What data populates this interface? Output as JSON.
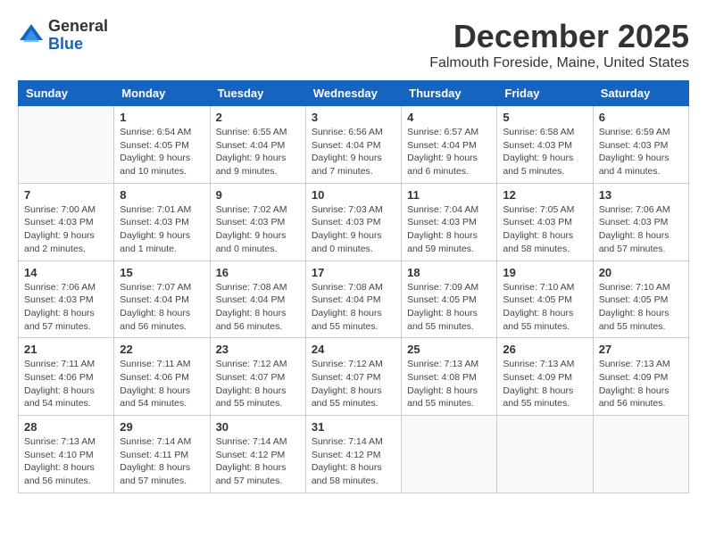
{
  "header": {
    "logo_general": "General",
    "logo_blue": "Blue",
    "month_title": "December 2025",
    "location": "Falmouth Foreside, Maine, United States"
  },
  "days_of_week": [
    "Sunday",
    "Monday",
    "Tuesday",
    "Wednesday",
    "Thursday",
    "Friday",
    "Saturday"
  ],
  "weeks": [
    [
      {
        "day": "",
        "info": ""
      },
      {
        "day": "1",
        "info": "Sunrise: 6:54 AM\nSunset: 4:05 PM\nDaylight: 9 hours\nand 10 minutes."
      },
      {
        "day": "2",
        "info": "Sunrise: 6:55 AM\nSunset: 4:04 PM\nDaylight: 9 hours\nand 9 minutes."
      },
      {
        "day": "3",
        "info": "Sunrise: 6:56 AM\nSunset: 4:04 PM\nDaylight: 9 hours\nand 7 minutes."
      },
      {
        "day": "4",
        "info": "Sunrise: 6:57 AM\nSunset: 4:04 PM\nDaylight: 9 hours\nand 6 minutes."
      },
      {
        "day": "5",
        "info": "Sunrise: 6:58 AM\nSunset: 4:03 PM\nDaylight: 9 hours\nand 5 minutes."
      },
      {
        "day": "6",
        "info": "Sunrise: 6:59 AM\nSunset: 4:03 PM\nDaylight: 9 hours\nand 4 minutes."
      }
    ],
    [
      {
        "day": "7",
        "info": "Sunrise: 7:00 AM\nSunset: 4:03 PM\nDaylight: 9 hours\nand 2 minutes."
      },
      {
        "day": "8",
        "info": "Sunrise: 7:01 AM\nSunset: 4:03 PM\nDaylight: 9 hours\nand 1 minute."
      },
      {
        "day": "9",
        "info": "Sunrise: 7:02 AM\nSunset: 4:03 PM\nDaylight: 9 hours\nand 0 minutes."
      },
      {
        "day": "10",
        "info": "Sunrise: 7:03 AM\nSunset: 4:03 PM\nDaylight: 9 hours\nand 0 minutes."
      },
      {
        "day": "11",
        "info": "Sunrise: 7:04 AM\nSunset: 4:03 PM\nDaylight: 8 hours\nand 59 minutes."
      },
      {
        "day": "12",
        "info": "Sunrise: 7:05 AM\nSunset: 4:03 PM\nDaylight: 8 hours\nand 58 minutes."
      },
      {
        "day": "13",
        "info": "Sunrise: 7:06 AM\nSunset: 4:03 PM\nDaylight: 8 hours\nand 57 minutes."
      }
    ],
    [
      {
        "day": "14",
        "info": "Sunrise: 7:06 AM\nSunset: 4:03 PM\nDaylight: 8 hours\nand 57 minutes."
      },
      {
        "day": "15",
        "info": "Sunrise: 7:07 AM\nSunset: 4:04 PM\nDaylight: 8 hours\nand 56 minutes."
      },
      {
        "day": "16",
        "info": "Sunrise: 7:08 AM\nSunset: 4:04 PM\nDaylight: 8 hours\nand 56 minutes."
      },
      {
        "day": "17",
        "info": "Sunrise: 7:08 AM\nSunset: 4:04 PM\nDaylight: 8 hours\nand 55 minutes."
      },
      {
        "day": "18",
        "info": "Sunrise: 7:09 AM\nSunset: 4:05 PM\nDaylight: 8 hours\nand 55 minutes."
      },
      {
        "day": "19",
        "info": "Sunrise: 7:10 AM\nSunset: 4:05 PM\nDaylight: 8 hours\nand 55 minutes."
      },
      {
        "day": "20",
        "info": "Sunrise: 7:10 AM\nSunset: 4:05 PM\nDaylight: 8 hours\nand 55 minutes."
      }
    ],
    [
      {
        "day": "21",
        "info": "Sunrise: 7:11 AM\nSunset: 4:06 PM\nDaylight: 8 hours\nand 54 minutes."
      },
      {
        "day": "22",
        "info": "Sunrise: 7:11 AM\nSunset: 4:06 PM\nDaylight: 8 hours\nand 54 minutes."
      },
      {
        "day": "23",
        "info": "Sunrise: 7:12 AM\nSunset: 4:07 PM\nDaylight: 8 hours\nand 55 minutes."
      },
      {
        "day": "24",
        "info": "Sunrise: 7:12 AM\nSunset: 4:07 PM\nDaylight: 8 hours\nand 55 minutes."
      },
      {
        "day": "25",
        "info": "Sunrise: 7:13 AM\nSunset: 4:08 PM\nDaylight: 8 hours\nand 55 minutes."
      },
      {
        "day": "26",
        "info": "Sunrise: 7:13 AM\nSunset: 4:09 PM\nDaylight: 8 hours\nand 55 minutes."
      },
      {
        "day": "27",
        "info": "Sunrise: 7:13 AM\nSunset: 4:09 PM\nDaylight: 8 hours\nand 56 minutes."
      }
    ],
    [
      {
        "day": "28",
        "info": "Sunrise: 7:13 AM\nSunset: 4:10 PM\nDaylight: 8 hours\nand 56 minutes."
      },
      {
        "day": "29",
        "info": "Sunrise: 7:14 AM\nSunset: 4:11 PM\nDaylight: 8 hours\nand 57 minutes."
      },
      {
        "day": "30",
        "info": "Sunrise: 7:14 AM\nSunset: 4:12 PM\nDaylight: 8 hours\nand 57 minutes."
      },
      {
        "day": "31",
        "info": "Sunrise: 7:14 AM\nSunset: 4:12 PM\nDaylight: 8 hours\nand 58 minutes."
      },
      {
        "day": "",
        "info": ""
      },
      {
        "day": "",
        "info": ""
      },
      {
        "day": "",
        "info": ""
      }
    ]
  ]
}
